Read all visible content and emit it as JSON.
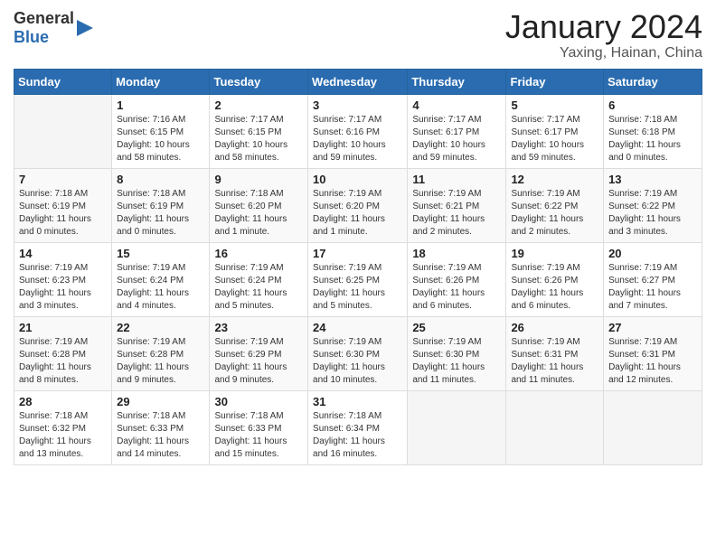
{
  "logo": {
    "general": "General",
    "blue": "Blue"
  },
  "title": {
    "month_year": "January 2024",
    "location": "Yaxing, Hainan, China"
  },
  "days_of_week": [
    "Sunday",
    "Monday",
    "Tuesday",
    "Wednesday",
    "Thursday",
    "Friday",
    "Saturday"
  ],
  "weeks": [
    [
      {
        "day": "",
        "info": ""
      },
      {
        "day": "1",
        "info": "Sunrise: 7:16 AM\nSunset: 6:15 PM\nDaylight: 10 hours\nand 58 minutes."
      },
      {
        "day": "2",
        "info": "Sunrise: 7:17 AM\nSunset: 6:15 PM\nDaylight: 10 hours\nand 58 minutes."
      },
      {
        "day": "3",
        "info": "Sunrise: 7:17 AM\nSunset: 6:16 PM\nDaylight: 10 hours\nand 59 minutes."
      },
      {
        "day": "4",
        "info": "Sunrise: 7:17 AM\nSunset: 6:17 PM\nDaylight: 10 hours\nand 59 minutes."
      },
      {
        "day": "5",
        "info": "Sunrise: 7:17 AM\nSunset: 6:17 PM\nDaylight: 10 hours\nand 59 minutes."
      },
      {
        "day": "6",
        "info": "Sunrise: 7:18 AM\nSunset: 6:18 PM\nDaylight: 11 hours\nand 0 minutes."
      }
    ],
    [
      {
        "day": "7",
        "info": "Sunrise: 7:18 AM\nSunset: 6:19 PM\nDaylight: 11 hours\nand 0 minutes."
      },
      {
        "day": "8",
        "info": "Sunrise: 7:18 AM\nSunset: 6:19 PM\nDaylight: 11 hours\nand 0 minutes."
      },
      {
        "day": "9",
        "info": "Sunrise: 7:18 AM\nSunset: 6:20 PM\nDaylight: 11 hours\nand 1 minute."
      },
      {
        "day": "10",
        "info": "Sunrise: 7:19 AM\nSunset: 6:20 PM\nDaylight: 11 hours\nand 1 minute."
      },
      {
        "day": "11",
        "info": "Sunrise: 7:19 AM\nSunset: 6:21 PM\nDaylight: 11 hours\nand 2 minutes."
      },
      {
        "day": "12",
        "info": "Sunrise: 7:19 AM\nSunset: 6:22 PM\nDaylight: 11 hours\nand 2 minutes."
      },
      {
        "day": "13",
        "info": "Sunrise: 7:19 AM\nSunset: 6:22 PM\nDaylight: 11 hours\nand 3 minutes."
      }
    ],
    [
      {
        "day": "14",
        "info": "Sunrise: 7:19 AM\nSunset: 6:23 PM\nDaylight: 11 hours\nand 3 minutes."
      },
      {
        "day": "15",
        "info": "Sunrise: 7:19 AM\nSunset: 6:24 PM\nDaylight: 11 hours\nand 4 minutes."
      },
      {
        "day": "16",
        "info": "Sunrise: 7:19 AM\nSunset: 6:24 PM\nDaylight: 11 hours\nand 5 minutes."
      },
      {
        "day": "17",
        "info": "Sunrise: 7:19 AM\nSunset: 6:25 PM\nDaylight: 11 hours\nand 5 minutes."
      },
      {
        "day": "18",
        "info": "Sunrise: 7:19 AM\nSunset: 6:26 PM\nDaylight: 11 hours\nand 6 minutes."
      },
      {
        "day": "19",
        "info": "Sunrise: 7:19 AM\nSunset: 6:26 PM\nDaylight: 11 hours\nand 6 minutes."
      },
      {
        "day": "20",
        "info": "Sunrise: 7:19 AM\nSunset: 6:27 PM\nDaylight: 11 hours\nand 7 minutes."
      }
    ],
    [
      {
        "day": "21",
        "info": "Sunrise: 7:19 AM\nSunset: 6:28 PM\nDaylight: 11 hours\nand 8 minutes."
      },
      {
        "day": "22",
        "info": "Sunrise: 7:19 AM\nSunset: 6:28 PM\nDaylight: 11 hours\nand 9 minutes."
      },
      {
        "day": "23",
        "info": "Sunrise: 7:19 AM\nSunset: 6:29 PM\nDaylight: 11 hours\nand 9 minutes."
      },
      {
        "day": "24",
        "info": "Sunrise: 7:19 AM\nSunset: 6:30 PM\nDaylight: 11 hours\nand 10 minutes."
      },
      {
        "day": "25",
        "info": "Sunrise: 7:19 AM\nSunset: 6:30 PM\nDaylight: 11 hours\nand 11 minutes."
      },
      {
        "day": "26",
        "info": "Sunrise: 7:19 AM\nSunset: 6:31 PM\nDaylight: 11 hours\nand 11 minutes."
      },
      {
        "day": "27",
        "info": "Sunrise: 7:19 AM\nSunset: 6:31 PM\nDaylight: 11 hours\nand 12 minutes."
      }
    ],
    [
      {
        "day": "28",
        "info": "Sunrise: 7:18 AM\nSunset: 6:32 PM\nDaylight: 11 hours\nand 13 minutes."
      },
      {
        "day": "29",
        "info": "Sunrise: 7:18 AM\nSunset: 6:33 PM\nDaylight: 11 hours\nand 14 minutes."
      },
      {
        "day": "30",
        "info": "Sunrise: 7:18 AM\nSunset: 6:33 PM\nDaylight: 11 hours\nand 15 minutes."
      },
      {
        "day": "31",
        "info": "Sunrise: 7:18 AM\nSunset: 6:34 PM\nDaylight: 11 hours\nand 16 minutes."
      },
      {
        "day": "",
        "info": ""
      },
      {
        "day": "",
        "info": ""
      },
      {
        "day": "",
        "info": ""
      }
    ]
  ]
}
